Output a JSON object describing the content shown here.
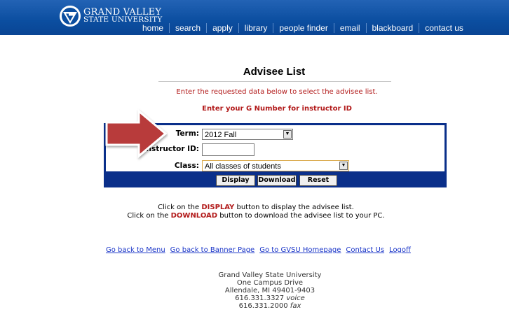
{
  "header": {
    "logo_line1": "GRAND VALLEY",
    "logo_line2": "STATE UNIVERSITY",
    "nav": [
      "home",
      "search",
      "apply",
      "library",
      "people finder",
      "email",
      "blackboard",
      "contact us"
    ]
  },
  "page": {
    "title": "Advisee List",
    "instruction": "Enter the requested data below to select the advisee list.",
    "gnumber_note": "Enter your G Number for instructor ID"
  },
  "form": {
    "term_label": "Term:",
    "term_value": "2012 Fall",
    "instructor_label": "Instructor ID:",
    "instructor_value": "",
    "class_label": "Class:",
    "class_value": "All classes of students",
    "display_label": "Display",
    "download_label": "Download",
    "reset_label": "Reset"
  },
  "help": {
    "line1_pre": "Click on the ",
    "line1_kw": "DISPLAY",
    "line1_post": " button to display the advisee list.",
    "line2_pre": "Click on the ",
    "line2_kw": "DOWNLOAD",
    "line2_post": " button to download the advisee list to your PC."
  },
  "links": [
    "Go back to Menu",
    "Go back to Banner Page",
    "Go to GVSU Homepage",
    "Contact Us",
    "Logoff"
  ],
  "footer": {
    "name": "Grand Valley State University",
    "street": "One Campus Drive",
    "city": "Allendale, MI 49401-9403",
    "phone": "616.331.3327",
    "phone_type": "voice",
    "fax": "616.331.2000",
    "fax_type": "fax"
  },
  "colors": {
    "header": "#0b4ea0",
    "form_band": "#0a2f8a",
    "emphasis": "#b21a1a",
    "link": "#1a35c8",
    "arrow": "#b83a3a"
  }
}
